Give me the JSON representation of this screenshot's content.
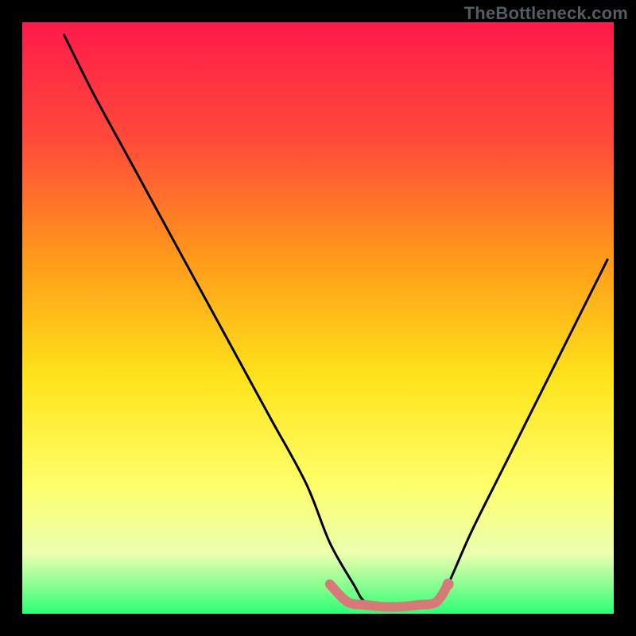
{
  "watermark": "TheBottleneck.com",
  "chart_data": {
    "type": "line",
    "title": "",
    "xlabel": "",
    "ylabel": "",
    "xlim": [
      0,
      100
    ],
    "ylim": [
      0,
      100
    ],
    "background_gradient": {
      "stops": [
        {
          "offset": 0.0,
          "color": "#ff1a4a"
        },
        {
          "offset": 0.2,
          "color": "#ff4a3a"
        },
        {
          "offset": 0.4,
          "color": "#ff9a1a"
        },
        {
          "offset": 0.6,
          "color": "#ffe31a"
        },
        {
          "offset": 0.78,
          "color": "#ffff6a"
        },
        {
          "offset": 0.9,
          "color": "#eaffb0"
        },
        {
          "offset": 1.0,
          "color": "#2cff74"
        }
      ]
    },
    "series": [
      {
        "name": "curve",
        "color": "#000000",
        "x": [
          7,
          12,
          18,
          24,
          30,
          36,
          42,
          48,
          52,
          56,
          58,
          62,
          66,
          70,
          72,
          76,
          82,
          88,
          94,
          99
        ],
        "values": [
          98,
          88,
          77,
          66,
          55,
          44,
          33,
          22,
          12,
          5,
          2,
          1,
          1,
          2,
          5,
          14,
          26,
          38,
          50,
          60
        ]
      },
      {
        "name": "optimal-band",
        "type": "band",
        "color": "#d87878",
        "x": [
          52,
          55,
          58,
          61,
          64,
          67,
          70,
          72
        ],
        "values": [
          5,
          2,
          1.5,
          1.2,
          1.2,
          1.5,
          2,
          5
        ]
      }
    ],
    "markers": [
      {
        "name": "dot-right",
        "x": 72,
        "y": 5,
        "color": "#d87878"
      }
    ]
  }
}
